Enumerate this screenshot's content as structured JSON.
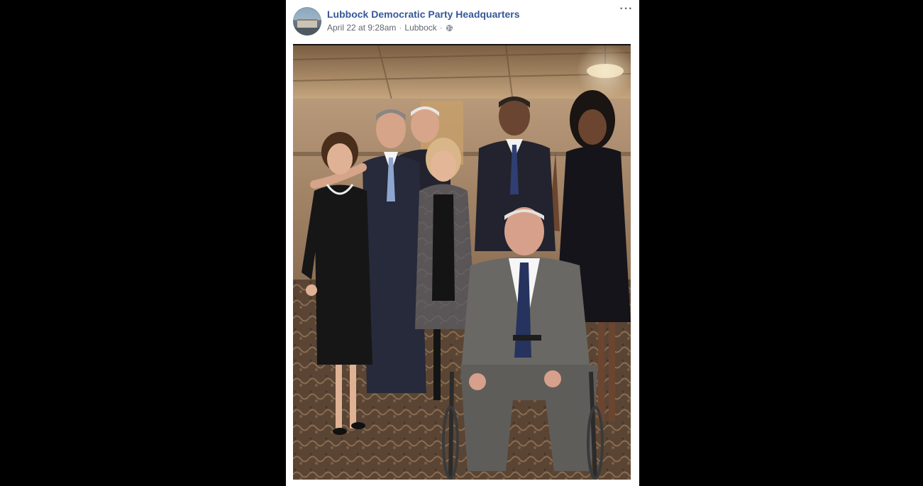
{
  "post": {
    "page_name": "Lubbock Democratic Party Headquarters",
    "date": "April 22 at 9:28am",
    "location": "Lubbock",
    "separator": "·",
    "privacy_icon": "globe-icon",
    "more_label": "···",
    "avatar_icon": "building-avatar"
  },
  "photo": {
    "kind": "group-portrait",
    "colors": {
      "ceiling": "#c9a982",
      "wall": "#a88868",
      "carpet": "#5a4534",
      "suit": "#2a2d3a",
      "grey_suit": "#6a6864"
    }
  },
  "colors": {
    "background": "#000000",
    "card": "#ffffff",
    "link": "#365899",
    "meta": "#616770"
  }
}
